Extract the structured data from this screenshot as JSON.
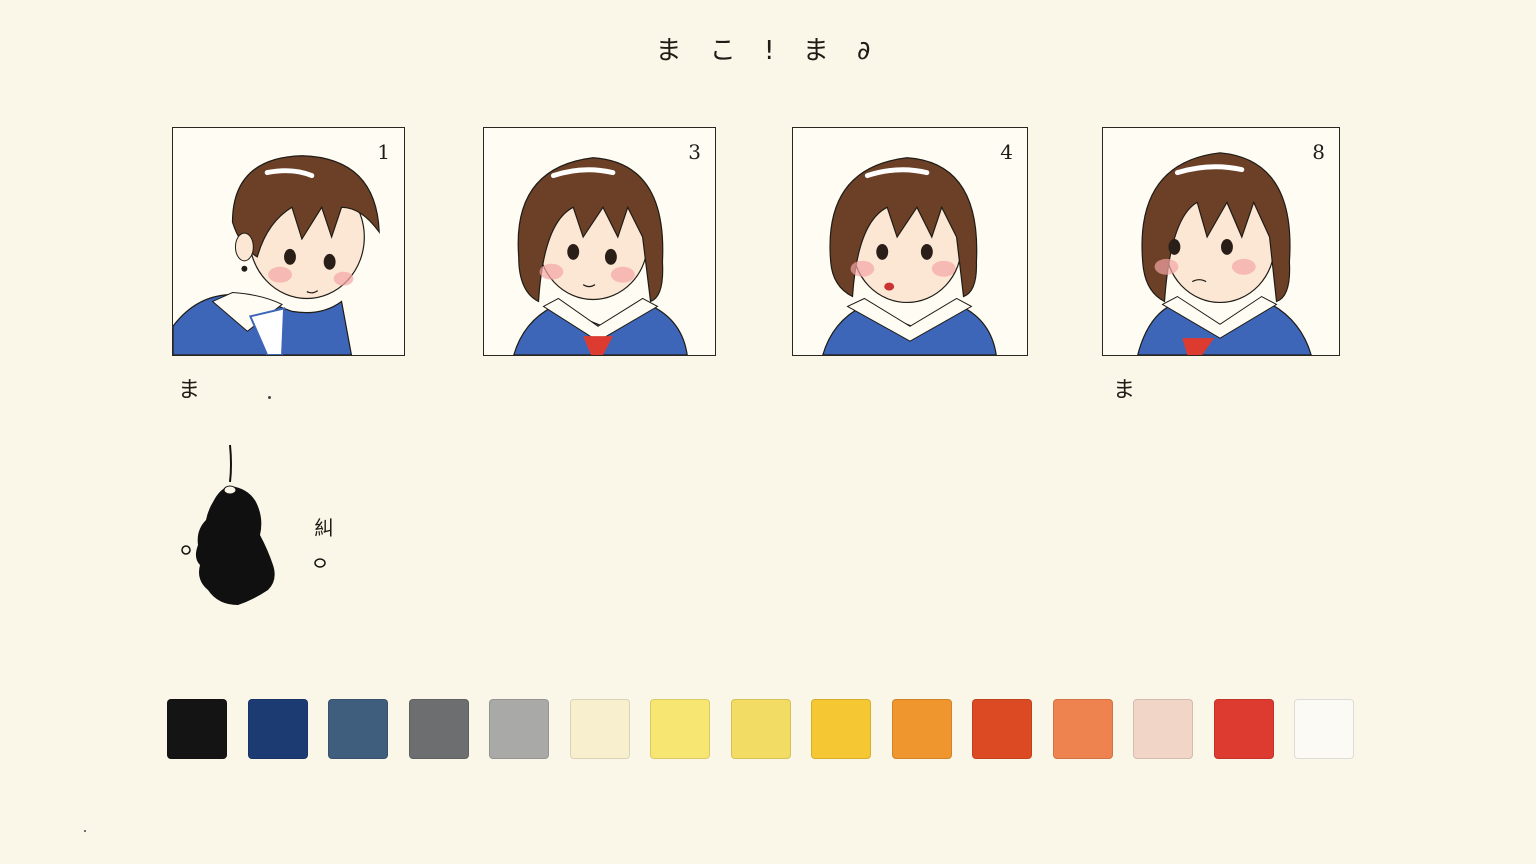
{
  "sheet": {
    "title": "ま こ ! ま ∂"
  },
  "panels": [
    {
      "number": "1"
    },
    {
      "number": "3"
    },
    {
      "number": "4"
    },
    {
      "number": "8"
    }
  ],
  "marks": {
    "left_mark": "ま",
    "right_mark": "ま",
    "sketch_note": "糾"
  },
  "palette": [
    {
      "name": "black",
      "color": "#141414"
    },
    {
      "name": "navy",
      "color": "#1d3b73"
    },
    {
      "name": "slate-blue",
      "color": "#3f5d7c"
    },
    {
      "name": "dark-gray",
      "color": "#6c6e6f"
    },
    {
      "name": "light-gray",
      "color": "#a9aaa7"
    },
    {
      "name": "cream",
      "color": "#f8efcf"
    },
    {
      "name": "pale-yellow",
      "color": "#f7e772"
    },
    {
      "name": "light-yellow",
      "color": "#f2dc64"
    },
    {
      "name": "yellow",
      "color": "#f5c732"
    },
    {
      "name": "orange",
      "color": "#f0962e"
    },
    {
      "name": "red-orange",
      "color": "#dc4a24"
    },
    {
      "name": "salmon",
      "color": "#ee8350"
    },
    {
      "name": "pale-pink",
      "color": "#f1d6c8"
    },
    {
      "name": "red",
      "color": "#dd3b2f"
    },
    {
      "name": "white",
      "color": "#fbfaf5"
    }
  ]
}
